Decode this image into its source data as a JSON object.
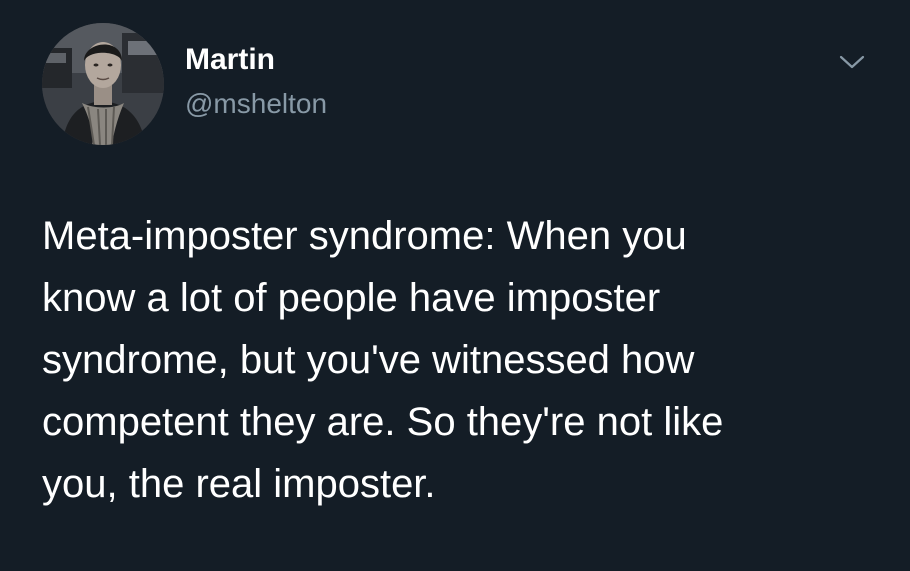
{
  "author": {
    "display_name": "Martin",
    "handle": "@mshelton",
    "avatar_icon": "profile-photo-icon"
  },
  "menu": {
    "icon": "chevron-down-icon"
  },
  "tweet": {
    "lines": [
      "Meta-imposter syndrome: When you",
      "know a lot of people have imposter",
      "syndrome, but you've witnessed how",
      "competent they are. So they're not like",
      "you, the real imposter."
    ]
  },
  "colors": {
    "background": "#141d26",
    "text_primary": "#ffffff",
    "text_secondary": "#8899a6"
  }
}
